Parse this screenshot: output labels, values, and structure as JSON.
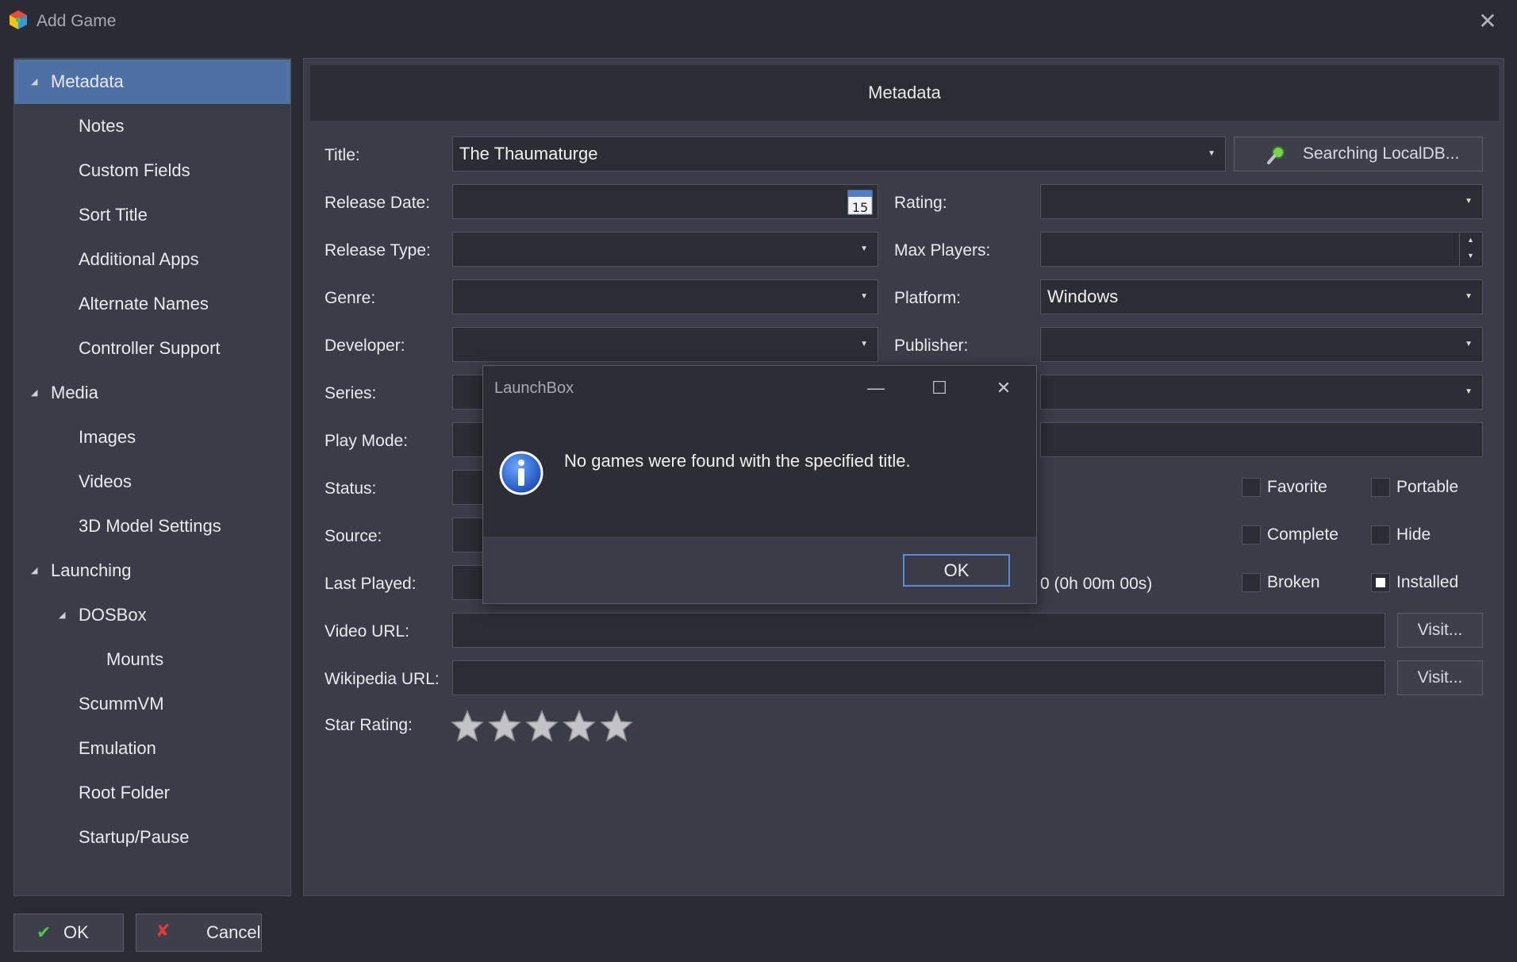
{
  "window": {
    "title": "Add Game",
    "close_glyph": "✕"
  },
  "sidebar": {
    "items": [
      {
        "label": "Metadata",
        "expanded": true,
        "level": 0,
        "selected": true
      },
      {
        "label": "Notes",
        "level": 1
      },
      {
        "label": "Custom Fields",
        "level": 1
      },
      {
        "label": "Sort Title",
        "level": 1
      },
      {
        "label": "Additional Apps",
        "level": 1
      },
      {
        "label": "Alternate Names",
        "level": 1
      },
      {
        "label": "Controller Support",
        "level": 1
      },
      {
        "label": "Media",
        "expanded": true,
        "level": 0
      },
      {
        "label": "Images",
        "level": 1
      },
      {
        "label": "Videos",
        "level": 1
      },
      {
        "label": "3D Model Settings",
        "level": 1
      },
      {
        "label": "Launching",
        "expanded": true,
        "level": 0
      },
      {
        "label": "DOSBox",
        "expanded": true,
        "level": 1
      },
      {
        "label": "Mounts",
        "level": 2
      },
      {
        "label": "ScummVM",
        "level": 1
      },
      {
        "label": "Emulation",
        "level": 1
      },
      {
        "label": "Root Folder",
        "level": 1
      },
      {
        "label": "Startup/Pause",
        "level": 1
      }
    ]
  },
  "main": {
    "header": "Metadata",
    "labels": {
      "title": "Title:",
      "release_date": "Release Date:",
      "rating": "Rating:",
      "release_type": "Release Type:",
      "max_players": "Max Players:",
      "genre": "Genre:",
      "platform": "Platform:",
      "developer": "Developer:",
      "publisher": "Publisher:",
      "series": "Series:",
      "play_mode": "Play Mode:",
      "status": "Status:",
      "source": "Source:",
      "last_played": "Last Played:",
      "video_url": "Video URL:",
      "wikipedia_url": "Wikipedia URL:",
      "star_rating": "Star Rating:"
    },
    "values": {
      "title": "The Thaumaturge",
      "platform": "Windows",
      "calendar_day": "15",
      "play_time": "0 (0h 00m 00s)"
    },
    "search_button": "Searching LocalDB...",
    "visit_button": "Visit...",
    "checkboxes": {
      "favorite": {
        "label": "Favorite",
        "checked": false
      },
      "portable": {
        "label": "Portable",
        "checked": false
      },
      "complete": {
        "label": "Complete",
        "checked": false
      },
      "hide": {
        "label": "Hide",
        "checked": false
      },
      "broken": {
        "label": "Broken",
        "checked": false
      },
      "installed": {
        "label": "Installed",
        "checked": true
      }
    },
    "star_rating": {
      "value": 0,
      "max": 5
    }
  },
  "footer": {
    "ok": "OK",
    "cancel": "Cancel"
  },
  "dialog": {
    "title": "LaunchBox",
    "message": "No games were found with the specified title.",
    "ok": "OK"
  },
  "colors": {
    "background": "#2a2b33",
    "panel": "#3a3c47",
    "selected": "#4f70a3",
    "focus": "#5a8ad8"
  }
}
